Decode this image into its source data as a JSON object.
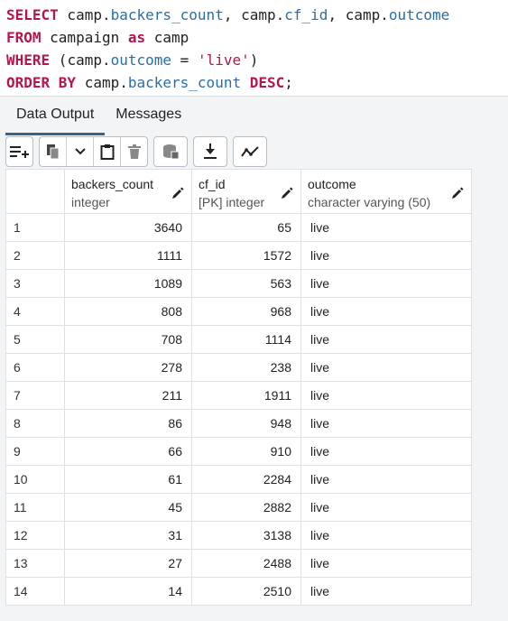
{
  "query": {
    "l1_kw": "SELECT",
    "l1_a": " camp.",
    "l1_b": "backers_count",
    "l1_c": ", camp.",
    "l1_d": "cf_id",
    "l1_e": ", camp.",
    "l1_f": "outcome",
    "l2_kw": "FROM",
    "l2_a": " campaign ",
    "l2_kw2": "as",
    "l2_b": " camp",
    "l3_kw": "WHERE",
    "l3_a": " (camp.",
    "l3_b": "outcome",
    "l3_c": " = ",
    "l3_str": "'live'",
    "l3_d": ")",
    "l4_kw": "ORDER BY",
    "l4_a": " camp.",
    "l4_b": "backers_count",
    "l4_kw2": " DESC",
    "l4_c": ";"
  },
  "tabs": [
    "Data Output",
    "Messages"
  ],
  "toolbar": {
    "icons": [
      "add-row-icon",
      "copy-icon",
      "chevron-down-icon",
      "paste-icon",
      "delete-icon",
      "save-data-icon",
      "download-icon",
      "graph-icon"
    ]
  },
  "columns": [
    {
      "name": "backers_count",
      "type": "integer"
    },
    {
      "name": "cf_id",
      "type": "[PK] integer"
    },
    {
      "name": "outcome",
      "type": "character varying (50)"
    }
  ],
  "rows": [
    [
      "1",
      "3640",
      "65",
      "live"
    ],
    [
      "2",
      "1111",
      "1572",
      "live"
    ],
    [
      "3",
      "1089",
      "563",
      "live"
    ],
    [
      "4",
      "808",
      "968",
      "live"
    ],
    [
      "5",
      "708",
      "1114",
      "live"
    ],
    [
      "6",
      "278",
      "238",
      "live"
    ],
    [
      "7",
      "211",
      "1911",
      "live"
    ],
    [
      "8",
      "86",
      "948",
      "live"
    ],
    [
      "9",
      "66",
      "910",
      "live"
    ],
    [
      "10",
      "61",
      "2284",
      "live"
    ],
    [
      "11",
      "45",
      "2882",
      "live"
    ],
    [
      "12",
      "31",
      "3138",
      "live"
    ],
    [
      "13",
      "27",
      "2488",
      "live"
    ],
    [
      "14",
      "14",
      "2510",
      "live"
    ]
  ]
}
